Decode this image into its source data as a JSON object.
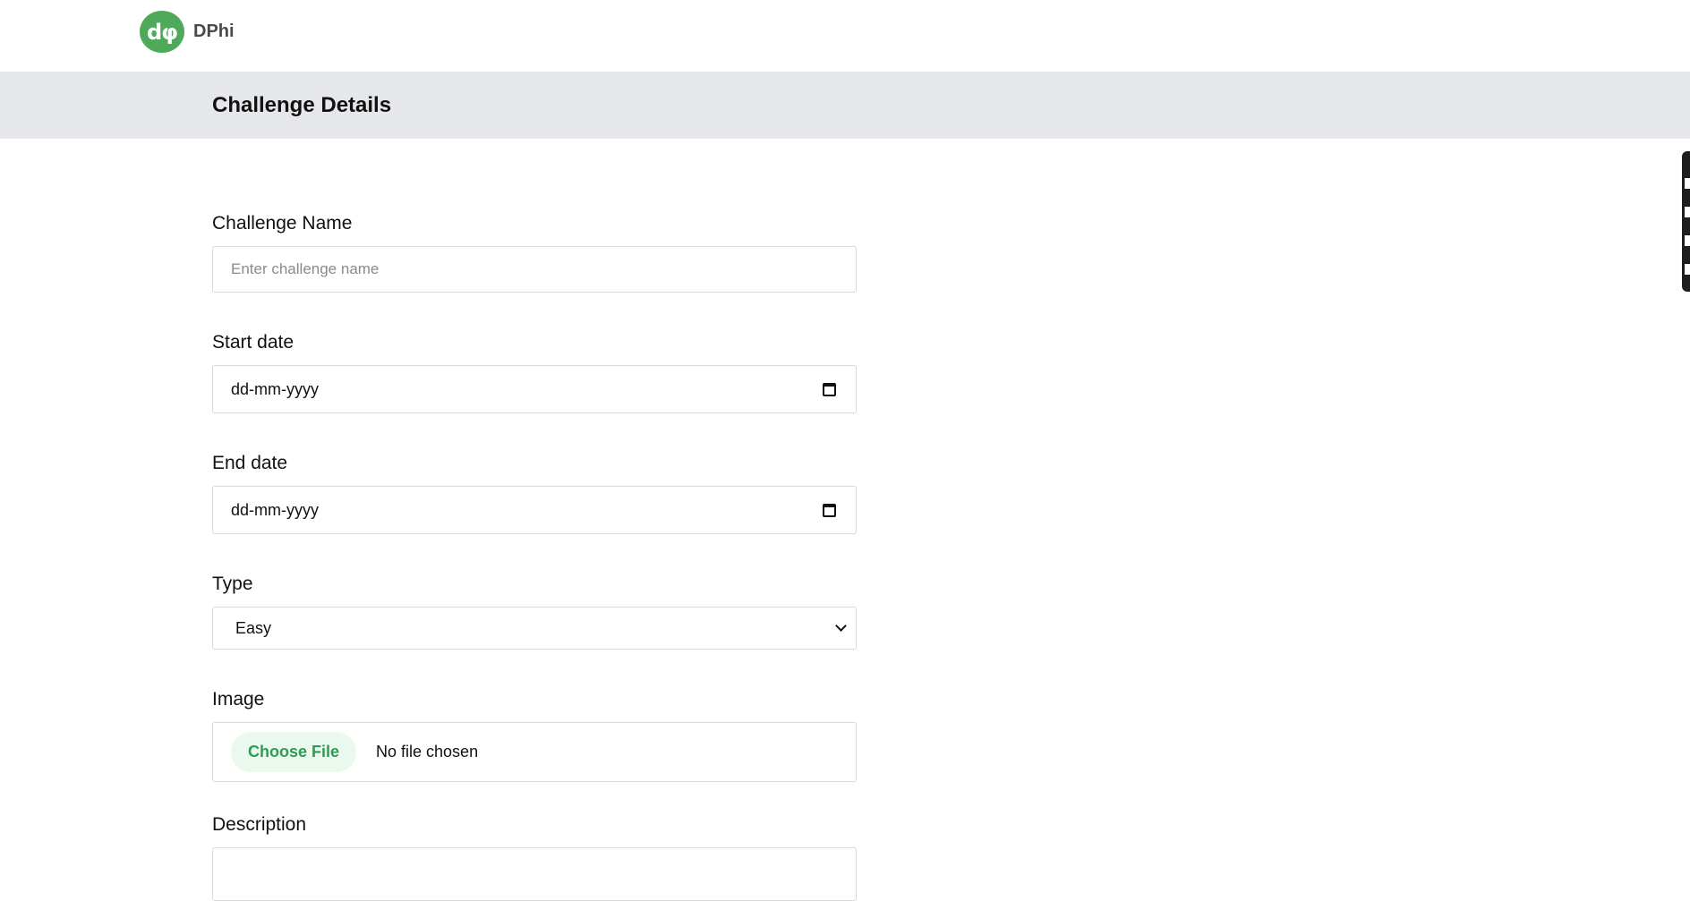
{
  "brand": {
    "logo_glyph": "dφ",
    "name": "DPhi",
    "color": "#4fa95a"
  },
  "page": {
    "title": "Challenge Details"
  },
  "form": {
    "challenge_name": {
      "label": "Challenge Name",
      "placeholder": "Enter challenge name",
      "value": ""
    },
    "start_date": {
      "label": "Start date",
      "value": "dd-mm-yyyy",
      "icon": "calendar-icon"
    },
    "end_date": {
      "label": "End date",
      "value": "dd-mm-yyyy",
      "icon": "calendar-icon"
    },
    "type": {
      "label": "Type",
      "selected": "Easy",
      "icon": "chevron-down-icon"
    },
    "image": {
      "label": "Image",
      "button_label": "Choose File",
      "status": "No file chosen",
      "button_color": "#2e9c52",
      "button_bg": "#eaf8ee"
    },
    "description": {
      "label": "Description"
    }
  },
  "colors": {
    "header_band": "#e6e7ea",
    "border": "#d9d9d9"
  }
}
